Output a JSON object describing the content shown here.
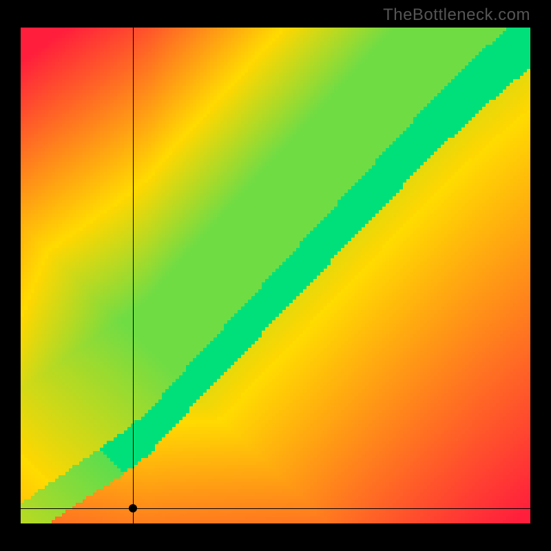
{
  "watermark": "TheBottleneck.com",
  "chart_data": {
    "type": "heatmap",
    "title": "",
    "xlabel": "",
    "ylabel": "",
    "xlim": [
      0,
      100
    ],
    "ylim": [
      0,
      100
    ],
    "legend": "none",
    "description": "Bottleneck compatibility heatmap. Color encodes bottleneck severity for a given CPU-vs-GPU performance pairing: green = balanced, yellow = mild bottleneck, red = severe bottleneck. The green diagonal band marks balanced combinations.",
    "color_scale": [
      {
        "value": 0,
        "meaning": "severe bottleneck",
        "color": "#ff1a3d"
      },
      {
        "value": 50,
        "meaning": "moderate",
        "color": "#ffd400"
      },
      {
        "value": 100,
        "meaning": "balanced",
        "color": "#00e07a"
      }
    ],
    "balanced_band": {
      "note": "Approximate center line of the green band in (x%, y%) of the plot, 0,0 = bottom-left.",
      "points": [
        [
          0,
          0
        ],
        [
          10,
          7
        ],
        [
          20,
          14
        ],
        [
          25,
          18
        ],
        [
          30,
          24
        ],
        [
          40,
          35
        ],
        [
          50,
          46
        ],
        [
          60,
          57
        ],
        [
          70,
          68
        ],
        [
          80,
          79
        ],
        [
          90,
          89
        ],
        [
          100,
          98
        ]
      ],
      "half_width_pct": 5
    },
    "marker": {
      "x_pct": 22,
      "y_pct": 3
    },
    "crosshair": {
      "x_pct": 22,
      "y_pct": 3
    }
  }
}
